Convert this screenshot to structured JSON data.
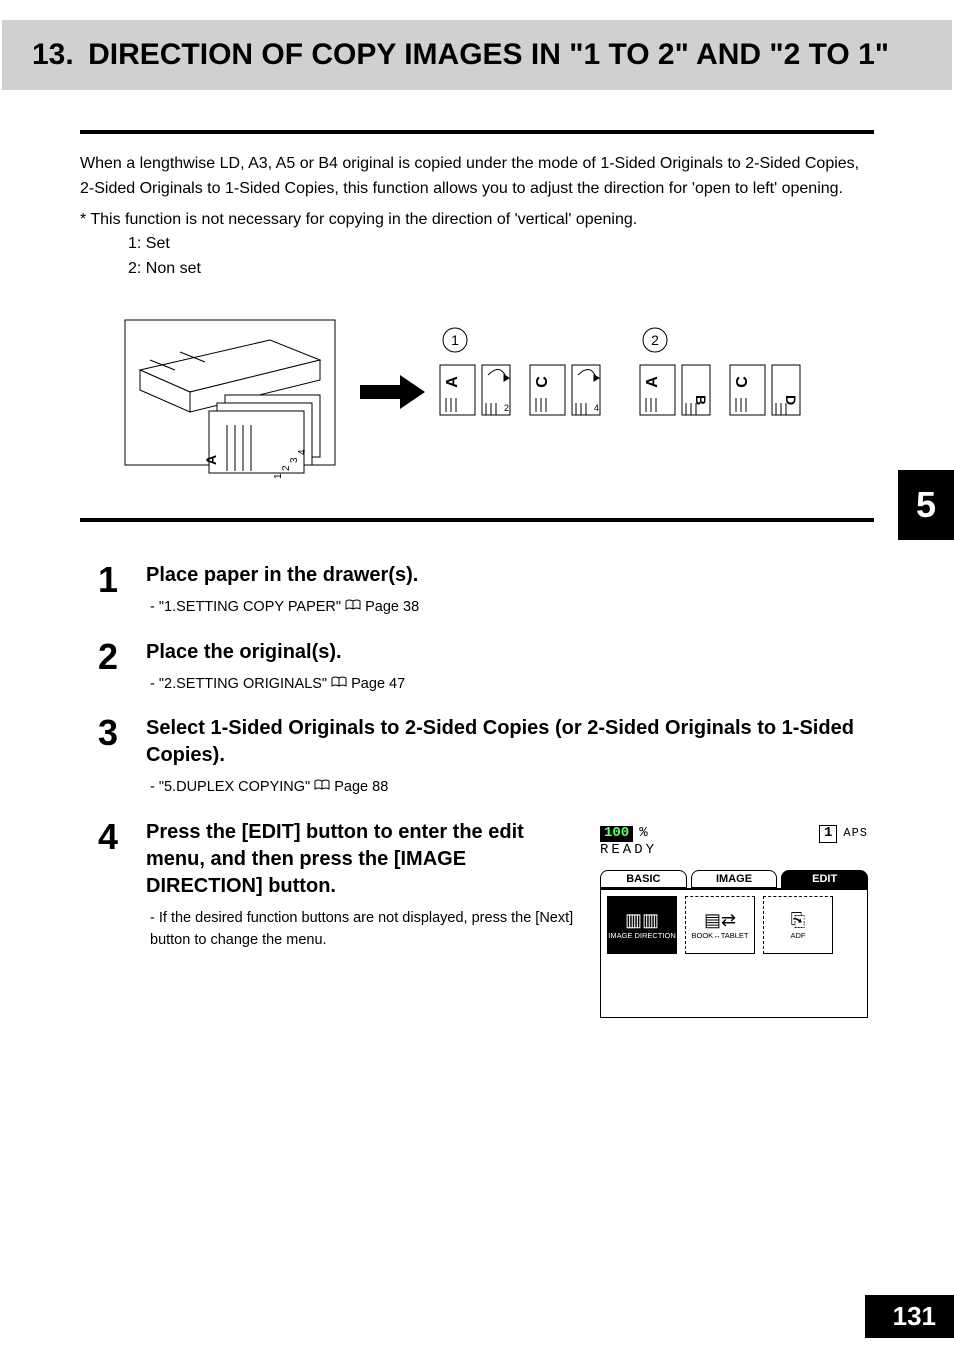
{
  "header": {
    "section_number": "13.",
    "title": "DIRECTION OF COPY IMAGES IN \"1 TO 2\" AND \"2 TO 1\""
  },
  "intro": "When a lengthwise LD, A3, A5 or B4 original is copied under the mode of 1-Sided Originals to 2-Sided Copies, 2-Sided Originals to 1-Sided Copies, this function allows you to adjust the direction for 'open to left' opening.",
  "note_lead": "*  This function is not necessary for copying in the direction of 'vertical' opening.",
  "note_1": "1: Set",
  "note_2": "2: Non set",
  "diagram": {
    "callout_1": "1",
    "callout_2": "2",
    "page_glyph_A": "A",
    "page_glyph_C": "C",
    "stack_1": "1",
    "stack_2": "2",
    "stack_3": "3",
    "stack_4": "4"
  },
  "chapter_tab": "5",
  "steps": {
    "s1": {
      "num": "1",
      "title": "Place paper in the drawer(s).",
      "sub_prefix": "-   ",
      "sub_ref": "\"1.SETTING COPY PAPER\"",
      "sub_page": "Page 38"
    },
    "s2": {
      "num": "2",
      "title": "Place the original(s).",
      "sub_prefix": "-   ",
      "sub_ref": "\"2.SETTING ORIGINALS\"",
      "sub_page": "Page 47"
    },
    "s3": {
      "num": "3",
      "title": "Select 1-Sided Originals to 2-Sided Copies (or 2-Sided Originals to 1-Sided Copies).",
      "sub_prefix": "-   ",
      "sub_ref": "\"5.DUPLEX COPYING\"",
      "sub_page": "Page 88"
    },
    "s4": {
      "num": "4",
      "title": "Press the [EDIT] button to enter the edit menu, and then press the [IMAGE DIRECTION] button.",
      "sub_prefix": "-   ",
      "sub_text": "If the desired function buttons are not displayed, press the [Next] button to change the menu."
    }
  },
  "lcd": {
    "zoom_value": "100",
    "zoom_pct": "%",
    "copies": "1",
    "mode": "APS",
    "status": "READY",
    "tab_basic": "BASIC",
    "tab_image": "IMAGE",
    "tab_edit": "EDIT",
    "btn_image_direction": "IMAGE DIRECTION",
    "btn_book_tablet": "BOOK↔TABLET",
    "btn_adf": "ADF"
  },
  "page_number": "131"
}
